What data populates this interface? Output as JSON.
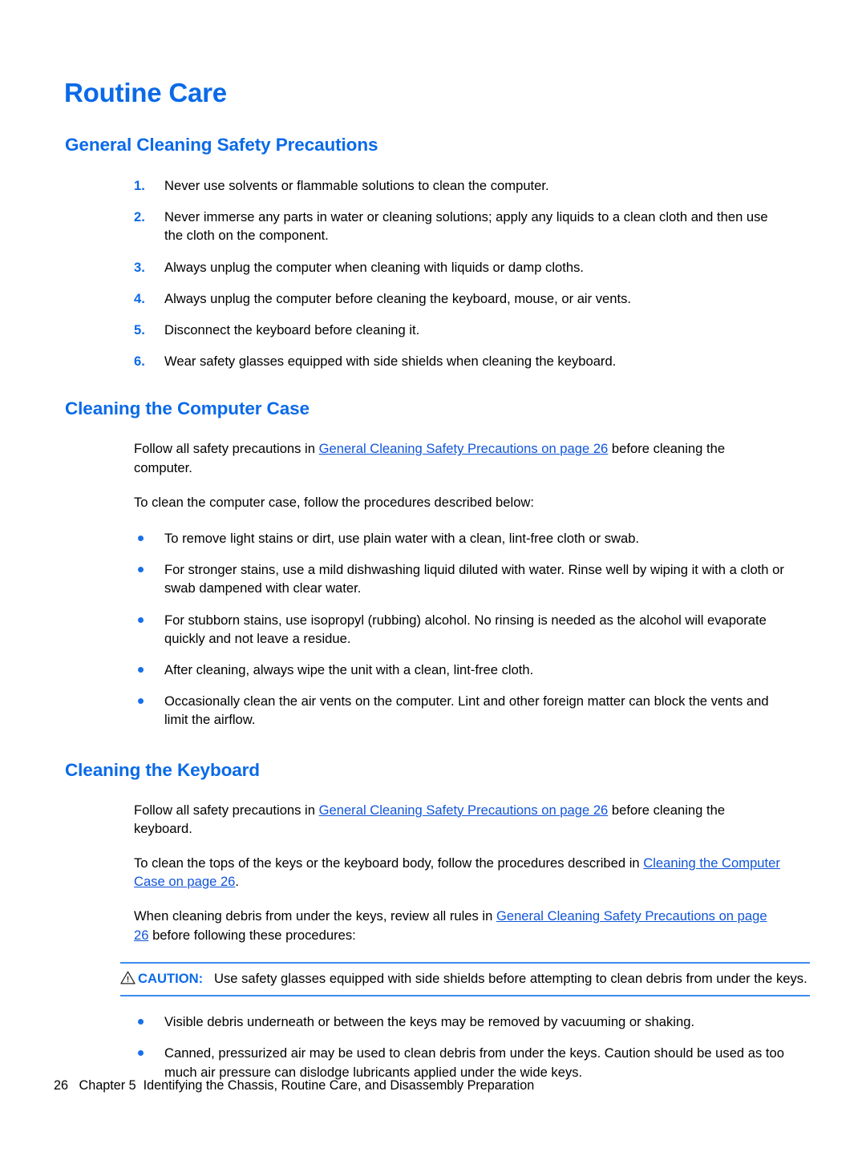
{
  "page": {
    "title": "Routine Care",
    "page_number": "26",
    "footer_chapter": "Chapter 5",
    "footer_title": "Identifying the Chassis, Routine Care, and Disassembly Preparation",
    "accent_blue": "#0a6ae8",
    "link_blue": "#1155d8",
    "rule_blue": "#3d8bf0"
  },
  "sections": {
    "general_cleaning": {
      "heading": "General Cleaning Safety Precautions",
      "items": [
        {
          "num": "1.",
          "text": "Never use solvents or flammable solutions to clean the computer."
        },
        {
          "num": "2.",
          "text": "Never immerse any parts in water or cleaning solutions; apply any liquids to a clean cloth and then use the cloth on the component."
        },
        {
          "num": "3.",
          "text": "Always unplug the computer when cleaning with liquids or damp cloths."
        },
        {
          "num": "4.",
          "text": "Always unplug the computer before cleaning the keyboard, mouse, or air vents."
        },
        {
          "num": "5.",
          "text": "Disconnect the keyboard before cleaning it."
        },
        {
          "num": "6.",
          "text": "Wear safety glasses equipped with side shields when cleaning the keyboard."
        }
      ]
    },
    "computer_case": {
      "heading": "Cleaning the Computer Case",
      "intro_before": "Follow all safety precautions in ",
      "intro_link": "General Cleaning Safety Precautions on page 26",
      "intro_after": " before cleaning the computer.",
      "procedures_line": "To clean the computer case, follow the procedures described below:",
      "bullets": [
        "To remove light stains or dirt, use plain water with a clean, lint-free cloth or swab.",
        "For stronger stains, use a mild dishwashing liquid diluted with water. Rinse well by wiping it with a cloth or swab dampened with clear water.",
        "For stubborn stains, use isopropyl (rubbing) alcohol. No rinsing is needed as the alcohol will evaporate quickly and not leave a residue.",
        "After cleaning, always wipe the unit with a clean, lint-free cloth.",
        "Occasionally clean the air vents on the computer. Lint and other foreign matter can block the vents and limit the airflow."
      ]
    },
    "keyboard": {
      "heading": "Cleaning the Keyboard",
      "p1_before": "Follow all safety precautions in ",
      "p1_link": "General Cleaning Safety Precautions on page 26",
      "p1_after": " before cleaning the keyboard.",
      "p2_before": "To clean the tops of the keys or the keyboard body, follow the procedures described in ",
      "p2_link": "Cleaning the Computer Case on page 26",
      "p2_after": ".",
      "p3_before": "When cleaning debris from under the keys, review all rules in ",
      "p3_link": "General Cleaning Safety Precautions on page 26",
      "p3_after": " before following these procedures:",
      "caution_label": "CAUTION:",
      "caution_text": "Use safety glasses equipped with side shields before attempting to clean debris from under the keys.",
      "bullets": [
        "Visible debris underneath or between the keys may be removed by vacuuming or shaking.",
        "Canned, pressurized air may be used to clean debris from under the keys. Caution should be used as too much air pressure can dislodge lubricants applied under the wide keys."
      ]
    }
  }
}
